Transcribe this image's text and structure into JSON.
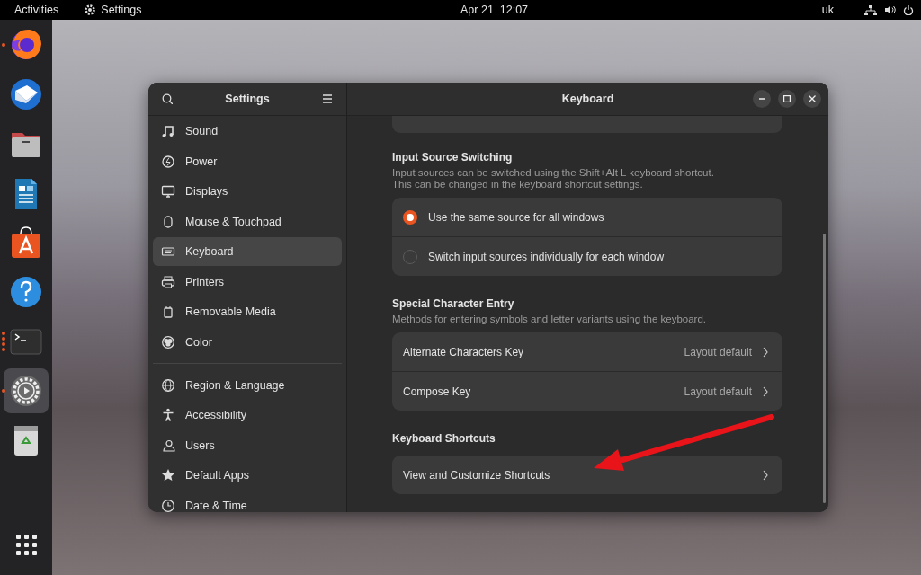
{
  "top_bar": {
    "activities": "Activities",
    "app_menu": "Settings",
    "clock": "Apr 21  12:07",
    "keyboard_layout": "uk"
  },
  "dock": {
    "items": [
      {
        "kind": "browser",
        "running": true,
        "selected": false
      },
      {
        "kind": "mail",
        "running": false,
        "selected": false
      },
      {
        "kind": "files",
        "running": false,
        "selected": false
      },
      {
        "kind": "writer",
        "running": false,
        "selected": false
      },
      {
        "kind": "store",
        "running": false,
        "selected": false
      },
      {
        "kind": "help",
        "running": false,
        "selected": false
      },
      {
        "kind": "terminal",
        "running": true,
        "selected": false
      },
      {
        "kind": "settings",
        "running": true,
        "selected": true
      },
      {
        "kind": "trash",
        "running": false,
        "selected": false
      }
    ]
  },
  "window": {
    "sidebar": {
      "title": "Settings",
      "groups": [
        [
          {
            "label": "Sound",
            "selected": false
          },
          {
            "label": "Power",
            "selected": false
          },
          {
            "label": "Displays",
            "selected": false
          },
          {
            "label": "Mouse & Touchpad",
            "selected": false
          },
          {
            "label": "Keyboard",
            "selected": true
          },
          {
            "label": "Printers",
            "selected": false
          },
          {
            "label": "Removable Media",
            "selected": false
          },
          {
            "label": "Color",
            "selected": false
          }
        ],
        [
          {
            "label": "Region & Language",
            "selected": false
          },
          {
            "label": "Accessibility",
            "selected": false
          },
          {
            "label": "Users",
            "selected": false
          },
          {
            "label": "Default Apps",
            "selected": false
          },
          {
            "label": "Date & Time",
            "selected": false
          }
        ]
      ]
    },
    "title": "Keyboard",
    "sections": [
      {
        "kind": "radio",
        "title": "Input Source Switching",
        "description": [
          "Input sources can be switched using the Shift+Alt L keyboard shortcut.",
          "This can be changed in the keyboard shortcut settings."
        ],
        "options": [
          {
            "label": "Use the same source for all windows",
            "selected": true
          },
          {
            "label": "Switch input sources individually for each window",
            "selected": false
          }
        ]
      },
      {
        "kind": "rows",
        "title": "Special Character Entry",
        "description": [
          "Methods for entering symbols and letter variants using the keyboard."
        ],
        "rows": [
          {
            "label": "Alternate Characters Key",
            "value": "Layout default"
          },
          {
            "label": "Compose Key",
            "value": "Layout default"
          }
        ]
      },
      {
        "kind": "rows",
        "title": "Keyboard Shortcuts",
        "rows": [
          {
            "label": "View and Customize Shortcuts"
          }
        ]
      }
    ]
  }
}
